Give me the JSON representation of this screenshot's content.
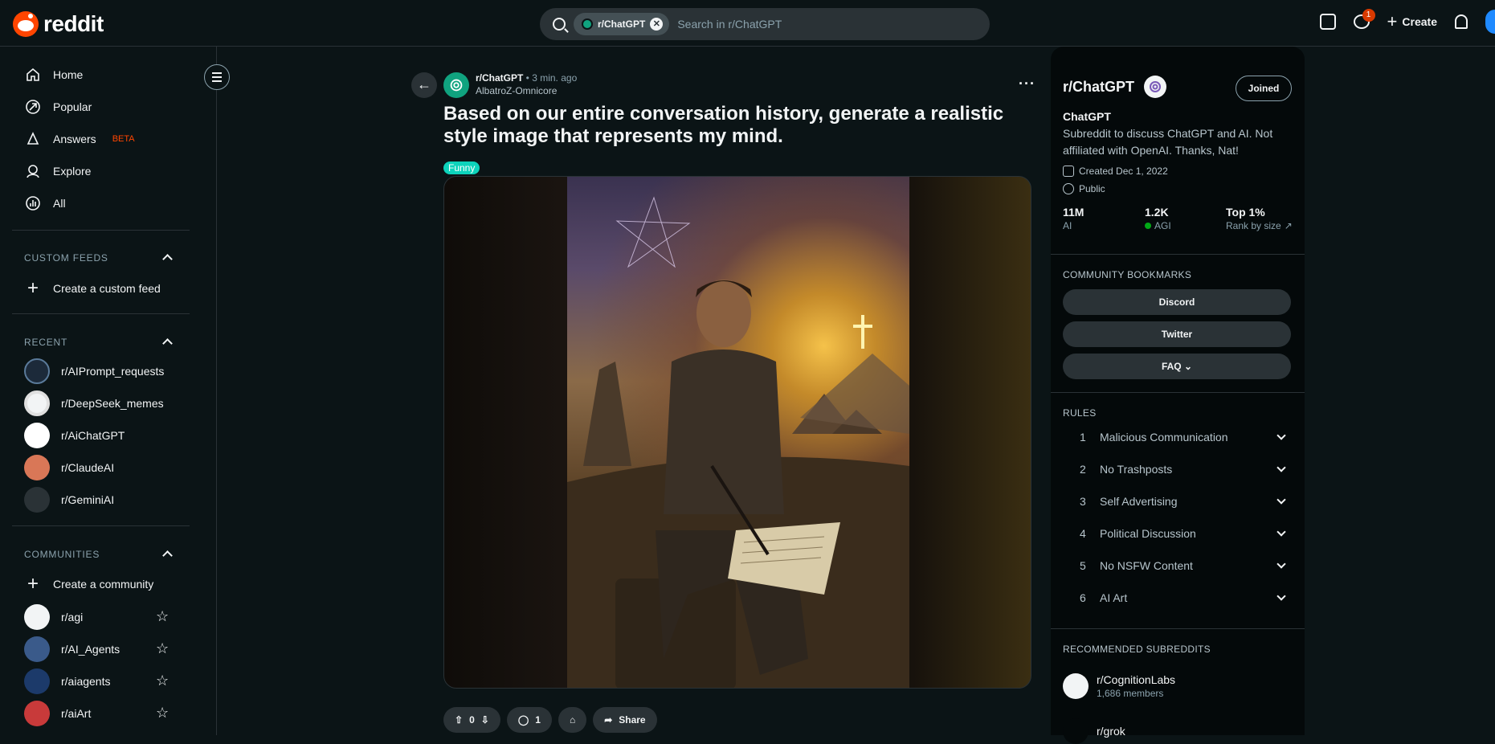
{
  "header": {
    "logo_text": "reddit",
    "search_chip": "r/ChatGPT",
    "search_placeholder": "Search in r/ChatGPT",
    "chat_badge": "1",
    "create_label": "Create"
  },
  "sidebar": {
    "nav": [
      {
        "label": "Home",
        "icon": "home-icon"
      },
      {
        "label": "Popular",
        "icon": "popular-icon"
      },
      {
        "label": "Answers",
        "icon": "answers-icon",
        "badge": "BETA"
      },
      {
        "label": "Explore",
        "icon": "explore-icon"
      },
      {
        "label": "All",
        "icon": "all-icon"
      }
    ],
    "custom_feeds": {
      "heading": "CUSTOM FEEDS",
      "create": "Create a custom feed"
    },
    "recent": {
      "heading": "RECENT",
      "items": [
        {
          "label": "r/AIPrompt_requests",
          "color": "#1c2a3a"
        },
        {
          "label": "r/DeepSeek_memes",
          "color": "#f2f4f5"
        },
        {
          "label": "r/AiChatGPT",
          "color": "#ffffff"
        },
        {
          "label": "r/ClaudeAI",
          "color": "#d97757"
        },
        {
          "label": "r/GeminiAI",
          "color": "#2a3236"
        }
      ]
    },
    "communities": {
      "heading": "COMMUNITIES",
      "create": "Create a community",
      "items": [
        {
          "label": "r/agi",
          "color": "#f2f4f5"
        },
        {
          "label": "r/AI_Agents",
          "color": "#3a5a8a"
        },
        {
          "label": "r/aiagents",
          "color": "#1c3a6a"
        },
        {
          "label": "r/aiArt",
          "color": "#c83a3a"
        }
      ]
    }
  },
  "post": {
    "subreddit": "r/ChatGPT",
    "time": " • 3 min. ago",
    "author": "AlbatroZ-Omnicore",
    "title": "Based on our entire conversation history, generate a realistic style image that represents my mind.",
    "flair": "Funny",
    "votes": "0",
    "comments": "1",
    "share_label": "Share"
  },
  "about": {
    "title": "r/ChatGPT",
    "joined_label": "Joined",
    "name": "ChatGPT",
    "description": "Subreddit to discuss ChatGPT and AI. Not affiliated with OpenAI. Thanks, Nat!",
    "created": "Created Dec 1, 2022",
    "visibility": "Public",
    "stats": [
      {
        "value": "11M",
        "label": "AI"
      },
      {
        "value": "1.2K",
        "label": "AGI"
      },
      {
        "value": "Top 1%",
        "label": "Rank by size"
      }
    ],
    "bookmarks_heading": "COMMUNITY BOOKMARKS",
    "bookmarks": [
      "Discord",
      "Twitter",
      "FAQ"
    ],
    "rules_heading": "RULES",
    "rules": [
      {
        "n": "1",
        "text": "Malicious Communication"
      },
      {
        "n": "2",
        "text": "No Trashposts"
      },
      {
        "n": "3",
        "text": "Self Advertising"
      },
      {
        "n": "4",
        "text": "Political Discussion"
      },
      {
        "n": "5",
        "text": "No NSFW Content"
      },
      {
        "n": "6",
        "text": "AI Art"
      }
    ],
    "recommended_heading": "RECOMMENDED SUBREDDITS",
    "recommended": [
      {
        "name": "r/CognitionLabs",
        "members": "1,686 members"
      },
      {
        "name": "r/grok",
        "members": ""
      }
    ]
  }
}
